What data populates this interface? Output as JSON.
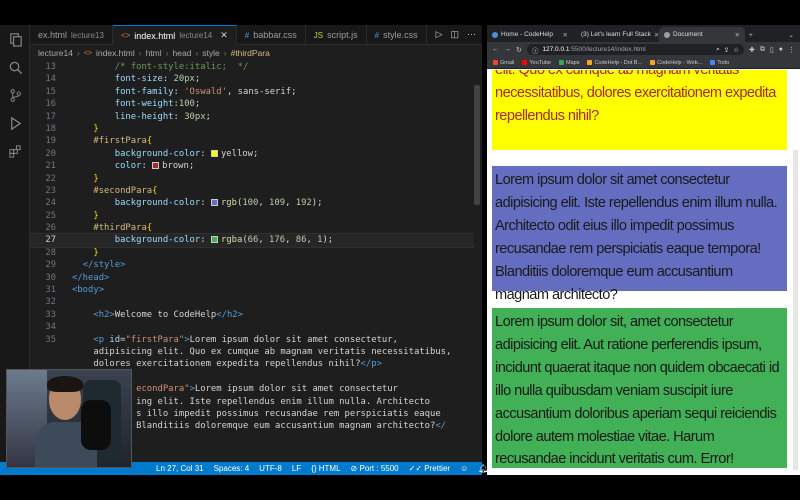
{
  "editor": {
    "tabs": [
      {
        "name": "ex.html",
        "desc": "lecture13",
        "icon": "html-icon",
        "active": false
      },
      {
        "name": "index.html",
        "desc": "lecture14",
        "icon": "html-icon",
        "active": true
      },
      {
        "name": "babbar.css",
        "desc": "",
        "icon": "css-icon",
        "active": false
      },
      {
        "name": "script.js",
        "desc": "",
        "icon": "js-icon",
        "active": false
      },
      {
        "name": "style.css",
        "desc": "",
        "icon": "css-icon",
        "active": false
      }
    ],
    "breadcrumb": [
      "lecture14",
      "index.html",
      "html",
      "head",
      "style",
      "#thirdPara"
    ],
    "status": {
      "position": "Ln 27, Col 31",
      "spaces": "Spaces: 4",
      "encoding": "UTF-8",
      "eol": "LF",
      "language": "HTML",
      "port": "Port : 5500",
      "formatter": "Prettier"
    }
  },
  "code_lines": [
    {
      "n": "13",
      "html": "        <span class='c-com'>/* font-style:italic;  */</span>"
    },
    {
      "n": "14",
      "html": "        <span class='c-prop'>font-size</span>: <span class='c-num'>20px</span>;"
    },
    {
      "n": "15",
      "html": "        <span class='c-prop'>font-family</span>: <span class='c-str'>'Oswald'</span>, sans-serif;"
    },
    {
      "n": "16",
      "html": "        <span class='c-prop'>font-weight</span>:<span class='c-num'>100</span>;"
    },
    {
      "n": "17",
      "html": "        <span class='c-prop'>line-height</span>: <span class='c-num'>30px</span>;"
    },
    {
      "n": "18",
      "html": "    <span class='c-brace'>}</span>"
    },
    {
      "n": "19",
      "html": "    <span class='c-sel'>#firstPara</span><span class='c-brace'>{</span>"
    },
    {
      "n": "20",
      "html": "        <span class='c-prop'>background-color</span>: <span class='sw' style='background:yellow'></span>yellow;"
    },
    {
      "n": "21",
      "html": "        <span class='c-prop'>color</span>: <span class='sw' style='background:brown'></span>brown;"
    },
    {
      "n": "22",
      "html": "    <span class='c-brace'>}</span>"
    },
    {
      "n": "23",
      "html": "    <span class='c-sel'>#secondPara</span><span class='c-brace'>{</span>"
    },
    {
      "n": "24",
      "html": "        <span class='c-prop'>background-color</span>: <span class='sw' style='background:rgb(100,109,192)'></span><span class='c-fn'>rgb</span>(<span class='c-num'>100</span>, <span class='c-num'>109</span>, <span class='c-num'>192</span>);"
    },
    {
      "n": "25",
      "html": "    <span class='c-brace'>}</span>"
    },
    {
      "n": "26",
      "html": "    <span class='c-sel'>#thirdPara</span><span class='c-brace'>{</span>"
    },
    {
      "n": "27",
      "html": "        <span class='c-prop'>background-color</span>: <span class='sw' style='background:rgb(66,176,86)'></span><span class='c-fn'>rgba</span>(<span class='c-num'>66</span>, <span class='c-num'>176</span>, <span class='c-num'>86</span>, <span class='c-num'>1</span>);",
      "current": true
    },
    {
      "n": "28",
      "html": "    <span class='c-brace'>}</span>"
    },
    {
      "n": "29",
      "html": "  <span class='c-tag'>&lt;/style&gt;</span>"
    },
    {
      "n": "30",
      "html": "<span class='c-tag'>&lt;/head&gt;</span>"
    },
    {
      "n": "31",
      "html": "<span class='c-tag'>&lt;body&gt;</span>"
    },
    {
      "n": "32",
      "html": ""
    },
    {
      "n": "33",
      "html": "    <span class='c-tag'>&lt;h2&gt;</span>Welcome to CodeHelp<span class='c-tag'>&lt;/h2&gt;</span>"
    },
    {
      "n": "34",
      "html": ""
    },
    {
      "n": "35",
      "html": "    <span class='c-tag'>&lt;p</span> <span class='c-attr'>id</span>=<span class='c-str'>\"firstPara\"</span><span class='c-tag'>&gt;</span>Lorem ipsum dolor sit amet consectetur,"
    },
    {
      "n": "",
      "html": "    adipisicing elit. Quo ex cumque ab magnam veritatis necessitatibus,"
    },
    {
      "n": "",
      "html": "    dolores exercitationem expedita repellendus nihil?<span class='c-tag'>&lt;/p&gt;</span>"
    },
    {
      "n": "",
      "html": ""
    },
    {
      "n": "",
      "html": "            <span class='c-str'>econdPara\"</span><span class='c-tag'>&gt;</span>Lorem ipsum dolor sit amet consectetur"
    },
    {
      "n": "",
      "html": "            ing elit. Iste repellendus enim illum nulla. Architecto"
    },
    {
      "n": "",
      "html": "            s illo impedit possimus recusandae rem perspiciatis eaque"
    },
    {
      "n": "",
      "html": "            Blanditiis doloremque eum accusantium magnam architecto?<span class='c-tag'>&lt;/</span>"
    }
  ],
  "browser": {
    "tabs": [
      {
        "title": "Home - CodeHelp",
        "color": "#4a90d9",
        "active": false
      },
      {
        "title": "(3) Let's learn Full Stack",
        "color": "#ff0000",
        "active": false
      },
      {
        "title": "Document",
        "color": "#9aa0a6",
        "active": true
      }
    ],
    "url_host": "127.0.0.1",
    "url_path": ":5500/lecture14/index.html",
    "bookmarks": [
      {
        "label": "Gmail",
        "color": "#ea4335"
      },
      {
        "label": "YouTube",
        "color": "#ff0000"
      },
      {
        "label": "Maps",
        "color": "#34a853"
      },
      {
        "label": "CodeHelp - Dot B...",
        "color": "#f5a623"
      },
      {
        "label": "CodeHelp - Web...",
        "color": "#f5a623"
      },
      {
        "label": "Todo",
        "color": "#4285f4"
      }
    ]
  },
  "page": {
    "first": "elit. Quo ex cumque ab magnam veritatis necessitatibus, dolores exercitationem expedita repellendus nihil?",
    "second": "Lorem ipsum dolor sit amet consectetur adipisicing elit. Iste repellendus enim illum nulla. Architecto odit eius illo impedit possimus recusandae rem perspiciatis eaque tempora! Blanditiis doloremque eum accusantium magnam architecto?",
    "third": "Lorem ipsum dolor sit, amet consectetur adipisicing elit. Aut ratione perferendis ipsum, incidunt quaerat itaque non quidem obcaecati id illo nulla quibusdam veniam suscipit iure accusantium doloribus aperiam sequi reiciendis dolore autem molestiae vitae. Harum recusandae incidunt veritatis cum. Error!"
  }
}
